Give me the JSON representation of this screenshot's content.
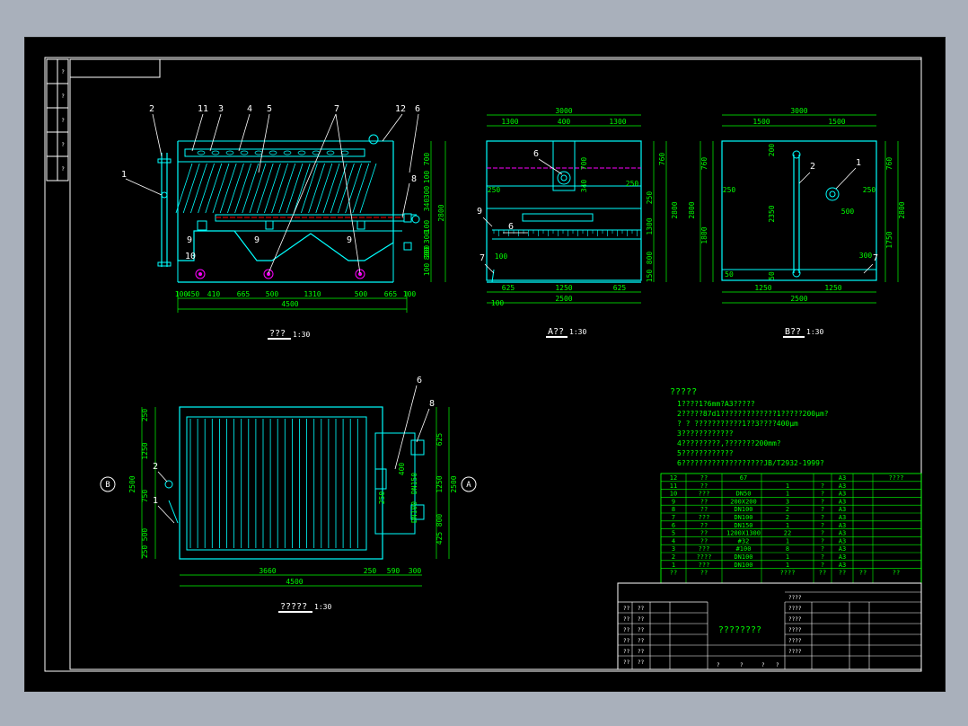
{
  "front_view": {
    "part_labels": [
      "2",
      "11",
      "3",
      "4",
      "5",
      "7",
      "12",
      "6",
      "1",
      "8",
      "9",
      "9",
      "9",
      "10",
      "9",
      "9"
    ],
    "dims_bottom": [
      "100",
      "450",
      "410",
      "665",
      "500",
      "1310",
      "500",
      "665",
      "100"
    ],
    "total_width": "4500",
    "dims_right": [
      "700",
      "100",
      "300",
      "340",
      "2800",
      "100",
      "300",
      "800",
      "100",
      "200"
    ],
    "caption": "???",
    "scale": "1:30"
  },
  "section_a": {
    "dims_top": [
      "3000",
      "1300",
      "400",
      "1300"
    ],
    "dims_bottom": [
      "625",
      "1250",
      "625",
      "2500",
      "100"
    ],
    "dims_left": [
      "250",
      "100"
    ],
    "dims_right": [
      "700",
      "340",
      "250",
      "760",
      "2800",
      "1300",
      "800",
      "150",
      "250"
    ],
    "part_labels": [
      "6",
      "9",
      "6",
      "7"
    ],
    "caption": "A??",
    "scale": "1:30"
  },
  "section_b": {
    "dims_top": [
      "3000",
      "1500",
      "1500"
    ],
    "dims_bottom": [
      "1250",
      "1250",
      "2500"
    ],
    "dims_left": [
      "760",
      "250",
      "2800",
      "1800",
      "50"
    ],
    "dims_right": [
      "760",
      "250",
      "2800",
      "1750",
      "300"
    ],
    "inner_dims": [
      "200",
      "2350",
      "500",
      "50"
    ],
    "part_labels": [
      "1",
      "2",
      "7"
    ],
    "caption": "B??",
    "scale": "1:30"
  },
  "plan_view": {
    "dims_left": [
      "250",
      "1250",
      "2500",
      "750",
      "500",
      "250"
    ],
    "dims_right": [
      "625",
      "1250",
      "2500",
      "425",
      "800"
    ],
    "dims_bottom": [
      "3660",
      "250",
      "590",
      "300",
      "4500"
    ],
    "inner_labels": [
      "DN150",
      "DN100",
      "400",
      "250"
    ],
    "part_labels": [
      "6",
      "8",
      "2",
      "1"
    ],
    "marker_a": "A",
    "marker_b": "B",
    "caption": "?????",
    "scale": "1:30"
  },
  "notes": {
    "title": "?????",
    "lines": [
      "1????1?6mm?A3?????",
      "2?????87d1?????????????1?????200μm?",
      "  ? ? ???????????1??3????400μm",
      "3????????????",
      "4?????????,???????200mm?",
      "5????????????",
      "6???????????????????JB/T2932-1999?"
    ]
  },
  "bom": {
    "rows": [
      [
        "12",
        "??",
        "67",
        "",
        "",
        "A3",
        "????"
      ],
      [
        "11",
        "??",
        "",
        "1",
        "?",
        "A3",
        ""
      ],
      [
        "10",
        "???",
        "DN50",
        "1",
        "?",
        "A3",
        ""
      ],
      [
        "9",
        "??",
        "200X200",
        "3",
        "?",
        "A3",
        ""
      ],
      [
        "8",
        "??",
        "DN100",
        "2",
        "?",
        "A3",
        ""
      ],
      [
        "7",
        "???",
        "DN100",
        "2",
        "?",
        "A3",
        ""
      ],
      [
        "6",
        "??",
        "DN150",
        "1",
        "?",
        "A3",
        ""
      ],
      [
        "5",
        "??",
        "1200X1300",
        "22",
        "?",
        "A3",
        ""
      ],
      [
        "4",
        "??",
        "#32",
        "1",
        "?",
        "A3",
        ""
      ],
      [
        "3",
        "???",
        "#100",
        "8",
        "?",
        "A3",
        ""
      ],
      [
        "2",
        "????",
        "DN100",
        "1",
        "?",
        "A3",
        ""
      ],
      [
        "1",
        "???",
        "DN100",
        "1",
        "?",
        "A3",
        ""
      ]
    ],
    "header": [
      "??",
      "??",
      "????",
      "??",
      "??",
      "??",
      "??"
    ]
  },
  "title_block": {
    "drawing_name": "????????",
    "right_labels": [
      "????",
      "????",
      "????",
      "????",
      "????",
      "????"
    ],
    "left_labels": [
      "??",
      "??",
      "??",
      "??",
      "??",
      "??"
    ],
    "bottom_row": [
      "?",
      "?",
      "?",
      "?"
    ]
  },
  "side_strip": {
    "labels": [
      "?",
      "?",
      "?",
      "?",
      "?"
    ]
  },
  "colors": {
    "outline": "#00ffff",
    "labels": "#ffffff",
    "dimensions": "#00ff00",
    "hidden": "#ff00ff",
    "axis": "#ff0000",
    "background": "#000000"
  }
}
